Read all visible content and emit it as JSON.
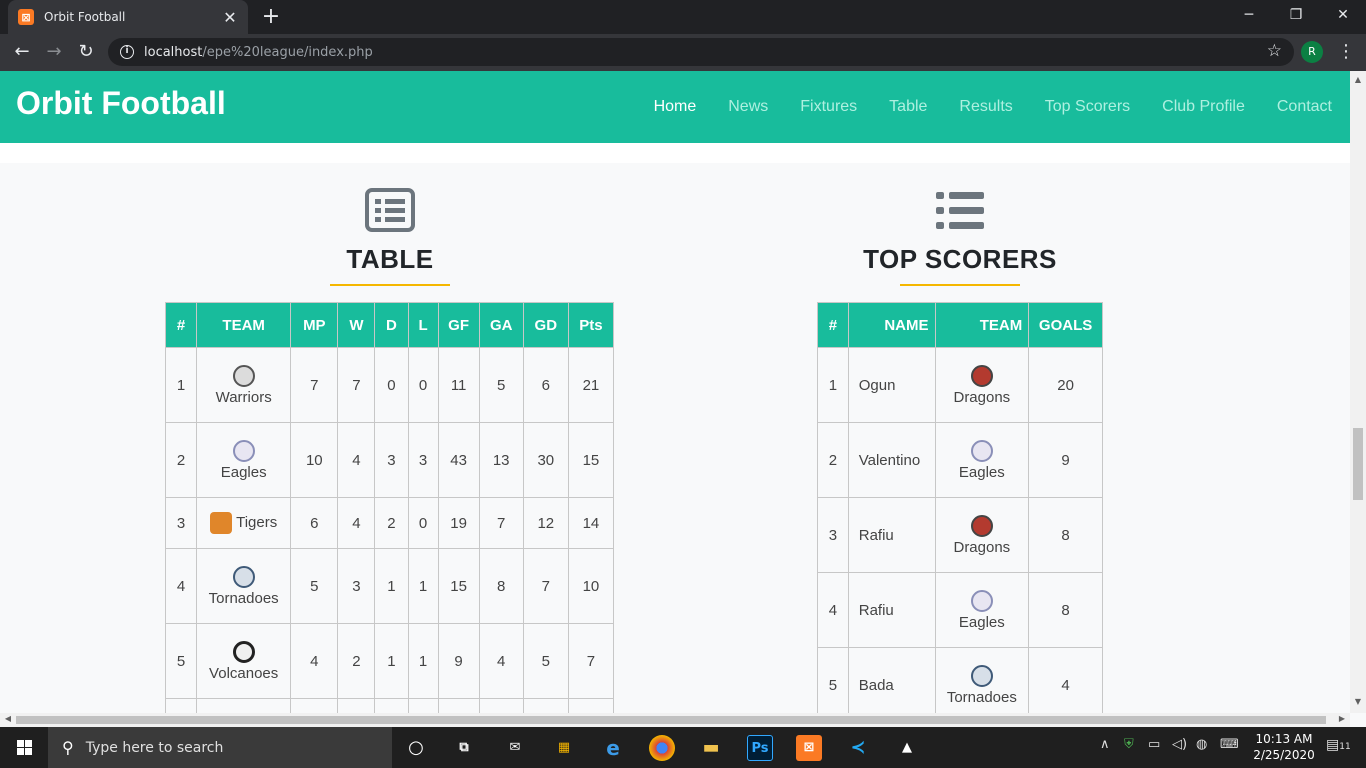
{
  "browser": {
    "tab_title": "Orbit Football",
    "favicon_label": "⊠",
    "url_host": "localhost",
    "url_path": "/epe%20league/index.php",
    "profile_initial": "R"
  },
  "site": {
    "brand": "Orbit Football",
    "nav": [
      "Home",
      "News",
      "Fixtures",
      "Table",
      "Results",
      "Top Scorers",
      "Club Profile",
      "Contact"
    ],
    "active_nav": "Home",
    "nav_color": "#18bc9c",
    "accent": "#f5b700"
  },
  "league_table": {
    "title": "TABLE",
    "icon": "list-alt-icon",
    "headers": [
      "#",
      "TEAM",
      "MP",
      "W",
      "D",
      "L",
      "GF",
      "GA",
      "GD",
      "Pts"
    ],
    "rows": [
      {
        "pos": "1",
        "team": "Warriors",
        "mp": "7",
        "w": "7",
        "d": "0",
        "l": "0",
        "gf": "11",
        "ga": "5",
        "gd": "6",
        "pts": "21"
      },
      {
        "pos": "2",
        "team": "Eagles",
        "mp": "10",
        "w": "4",
        "d": "3",
        "l": "3",
        "gf": "43",
        "ga": "13",
        "gd": "30",
        "pts": "15"
      },
      {
        "pos": "3",
        "team": "Tigers",
        "mp": "6",
        "w": "4",
        "d": "2",
        "l": "0",
        "gf": "19",
        "ga": "7",
        "gd": "12",
        "pts": "14"
      },
      {
        "pos": "4",
        "team": "Tornadoes",
        "mp": "5",
        "w": "3",
        "d": "1",
        "l": "1",
        "gf": "15",
        "ga": "8",
        "gd": "7",
        "pts": "10"
      },
      {
        "pos": "5",
        "team": "Volcanoes",
        "mp": "4",
        "w": "2",
        "d": "1",
        "l": "1",
        "gf": "9",
        "ga": "4",
        "gd": "5",
        "pts": "7"
      }
    ]
  },
  "top_scorers": {
    "title": "TOP SCORERS",
    "icon": "list-icon",
    "headers": [
      "#",
      "NAME",
      "TEAM",
      "GOALS"
    ],
    "rows": [
      {
        "pos": "1",
        "name": "Ogun",
        "team": "Dragons",
        "goals": "20"
      },
      {
        "pos": "2",
        "name": "Valentino",
        "team": "Eagles",
        "goals": "9"
      },
      {
        "pos": "3",
        "name": "Rafiu",
        "team": "Dragons",
        "goals": "8"
      },
      {
        "pos": "4",
        "name": "Rafiu",
        "team": "Eagles",
        "goals": "8"
      },
      {
        "pos": "5",
        "name": "Bada",
        "team": "Tornadoes",
        "goals": "4"
      }
    ]
  },
  "taskbar": {
    "search_placeholder": "Type here to search",
    "time": "10:13 AM",
    "date": "2/25/2020",
    "notification_count": "11"
  }
}
